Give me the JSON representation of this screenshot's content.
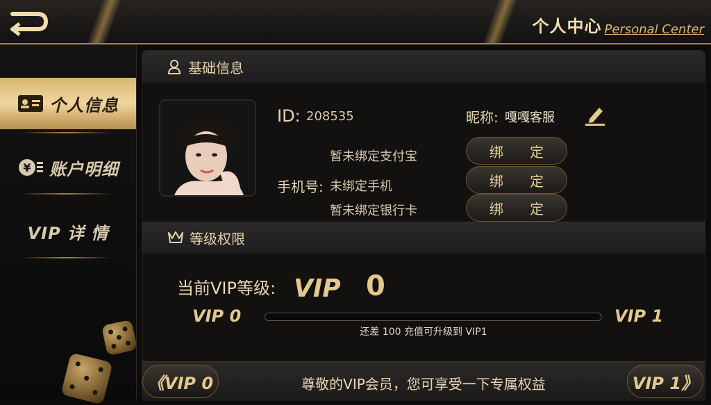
{
  "header": {
    "title_cn": "个人中心",
    "title_en": "Personal Center"
  },
  "sidebar": {
    "items": [
      {
        "label": "个人信息",
        "icon": "id-card-icon",
        "active": true
      },
      {
        "label": "账户明细",
        "icon": "yen-coin-icon",
        "active": false
      },
      {
        "label": "VIP 详 情",
        "icon": "",
        "active": false
      }
    ]
  },
  "basic_info": {
    "section_title": "基础信息",
    "id_label": "ID:",
    "id_value": "208535",
    "nickname_label": "昵称:",
    "nickname_value": "嘎嘎客服",
    "alipay_status": "暂未绑定支付宝",
    "phone_label": "手机号:",
    "phone_status": "未绑定手机",
    "bank_status": "暂未绑定银行卡",
    "bind_label": "绑 定"
  },
  "level": {
    "section_title": "等级权限",
    "current_label": "当前VIP等级:",
    "vip_word": "VIP",
    "current_level": "0",
    "from_label": "VIP 0",
    "to_label": "VIP 1",
    "progress_fraction": 0,
    "progress_note": "还差 100 充值可升级到 VIP1"
  },
  "bottom": {
    "message": "尊敬的VIP会员，您可享受一下专属权益",
    "prev_label": "《VIP 0",
    "next_label": "VIP 1》"
  },
  "colors": {
    "accent_gold": "#e4c88f",
    "background": "#0d0c0b"
  }
}
